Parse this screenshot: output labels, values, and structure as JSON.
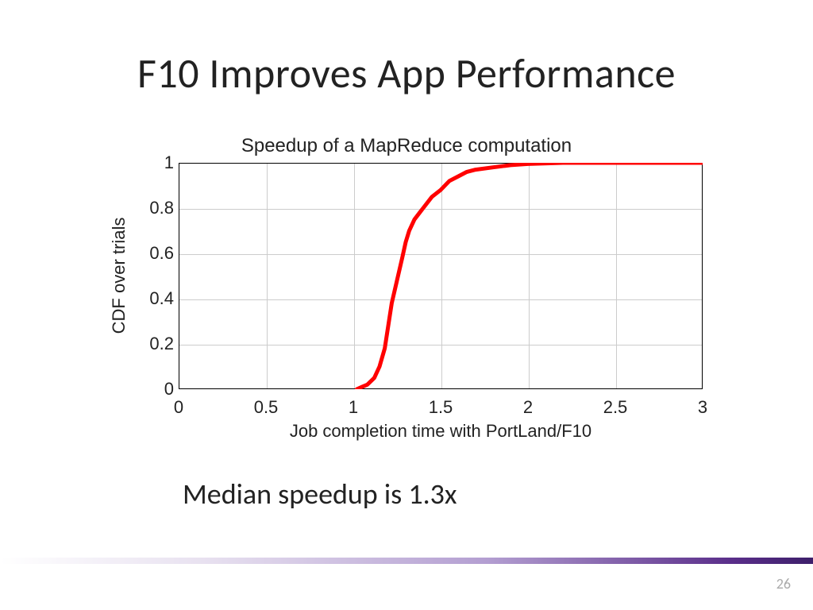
{
  "slide": {
    "title": "F10 Improves App Performance",
    "caption": "Median speedup is 1.3x",
    "page_number": "26"
  },
  "chart_data": {
    "type": "line",
    "title": "Speedup of a MapReduce computation",
    "xlabel": "Job completion time with PortLand/F10",
    "ylabel": "CDF over trials",
    "xlim": [
      0,
      3
    ],
    "ylim": [
      0,
      1
    ],
    "xticks": [
      0,
      0.5,
      1,
      1.5,
      2,
      2.5,
      3
    ],
    "yticks": [
      0,
      0.2,
      0.4,
      0.6,
      0.8,
      1
    ],
    "series": [
      {
        "name": "CDF",
        "color": "#ff0000",
        "x": [
          1.02,
          1.05,
          1.08,
          1.12,
          1.15,
          1.18,
          1.2,
          1.22,
          1.25,
          1.28,
          1.3,
          1.32,
          1.35,
          1.38,
          1.4,
          1.45,
          1.5,
          1.55,
          1.6,
          1.65,
          1.7,
          1.8,
          1.9,
          2.0,
          2.2,
          2.5,
          3.0
        ],
        "y": [
          0.0,
          0.01,
          0.02,
          0.05,
          0.1,
          0.18,
          0.28,
          0.38,
          0.48,
          0.58,
          0.65,
          0.7,
          0.75,
          0.78,
          0.8,
          0.85,
          0.88,
          0.92,
          0.94,
          0.96,
          0.97,
          0.98,
          0.99,
          0.995,
          1.0,
          1.0,
          1.0
        ]
      }
    ]
  }
}
